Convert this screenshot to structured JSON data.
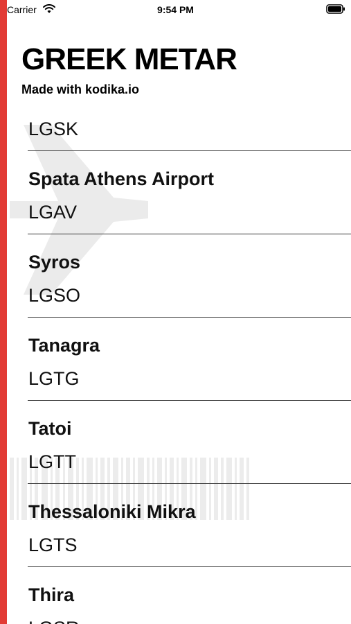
{
  "status_bar": {
    "carrier": "Carrier",
    "time": "9:54 PM"
  },
  "header": {
    "title": "GREEK METAR",
    "subtitle": "Made with kodika.io"
  },
  "list": {
    "partial_top_code": "LGSK",
    "items": [
      {
        "name": "Spata Athens Airport",
        "code": "LGAV"
      },
      {
        "name": "Syros",
        "code": "LGSO"
      },
      {
        "name": "Tanagra",
        "code": "LGTG"
      },
      {
        "name": "Tatoi",
        "code": "LGTT"
      },
      {
        "name": "Thessaloniki Mikra",
        "code": "LGTS"
      },
      {
        "name": "Thira",
        "code": "LGSR"
      }
    ]
  },
  "colors": {
    "accent": "#e23b35",
    "background": "#ffffff",
    "text": "#111111"
  }
}
